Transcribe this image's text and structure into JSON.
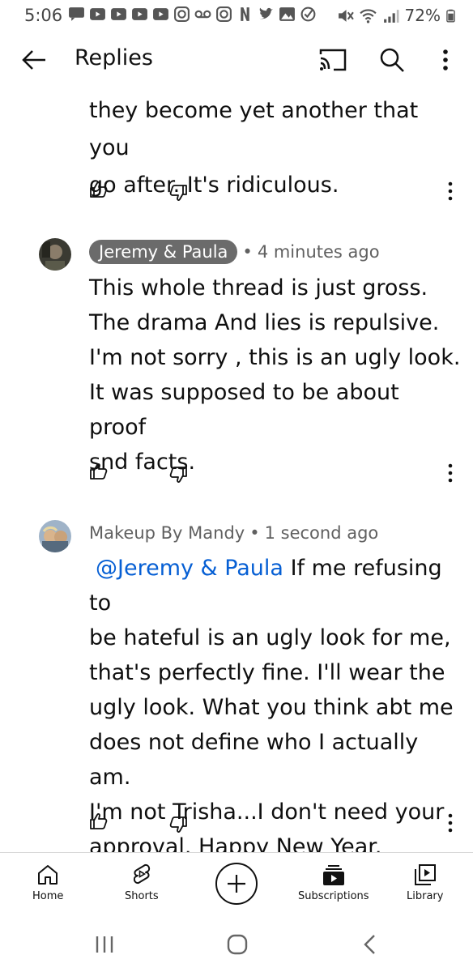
{
  "status": {
    "time": "5:06",
    "battery": "72%",
    "icons": [
      "message-icon",
      "youtube-icon",
      "youtube-icon",
      "youtube-icon",
      "youtube-icon",
      "instagram-icon",
      "voicemail-icon",
      "instagram-icon",
      "netflix-icon",
      "twitter-icon",
      "gallery-icon",
      "check-circle-icon",
      "mute-icon",
      "wifi-icon",
      "signal-icon"
    ]
  },
  "appbar": {
    "title": "Replies",
    "icons": [
      "back-arrow-icon",
      "cast-icon",
      "search-icon",
      "more-vert-icon"
    ]
  },
  "comments": [
    {
      "tail_lines": [
        "they become yet another that you",
        "go after. It's ridiculous."
      ]
    },
    {
      "author": "Jeremy & Paula",
      "time": "4 minutes ago",
      "lines": [
        "This whole thread is just gross.",
        "The drama And lies is repulsive.",
        "I'm not sorry , this is an ugly look.",
        "It was supposed to be about proof",
        "snd facts."
      ]
    },
    {
      "author": "Makeup By Mandy",
      "time": "1 second ago",
      "mention": "@Jeremy & Paula",
      "first_line_rest": "If me refusing to",
      "lines": [
        "be hateful is an ugly look for me,",
        "that's perfectly fine. I'll wear the",
        "ugly look. What you think abt me",
        "does not define who I actually am.",
        "I'm not Trisha...I don't need your",
        "approval. Happy New Year."
      ]
    }
  ],
  "bottom_nav": {
    "home": "Home",
    "shorts": "Shorts",
    "create": "",
    "subscriptions": "Subscriptions",
    "library": "Library"
  },
  "colors": {
    "mention": "#065fd4",
    "author_pill": "#6b6b6b",
    "meta_text": "#606060"
  }
}
